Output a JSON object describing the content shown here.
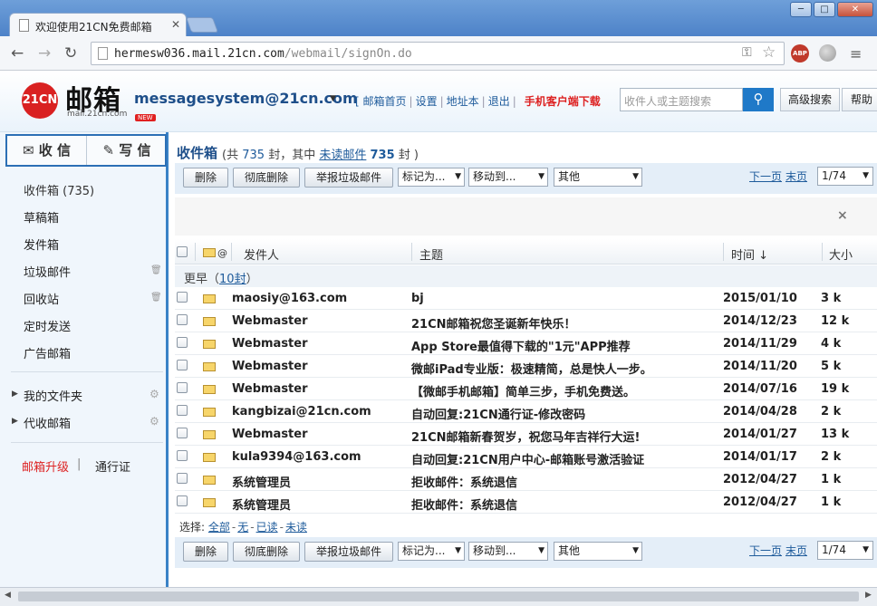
{
  "browser": {
    "tab_title": "欢迎使用21CN免费邮箱",
    "url_host": "hermesw036.mail.21cn.com",
    "url_path": "/webmail/signOn.do",
    "abp_label": "ABP",
    "min": "─",
    "max": "□",
    "close": "✕"
  },
  "header": {
    "logo_badge": "21CN",
    "logo_text": "邮箱",
    "logo_sub": "mail.21cn.com",
    "new_badge": "NEW",
    "account": "messagesystem@21cn.com",
    "links": [
      "邮箱首页",
      "设置",
      "地址本",
      "退出"
    ],
    "mobile_link": "手机客户端下载",
    "search_placeholder": "收件人或主题搜索",
    "advanced_search": "高级搜索",
    "help": "帮助"
  },
  "sidebar": {
    "receive": "收 信",
    "write": "写 信",
    "folders": [
      {
        "label": "收件箱 (735)",
        "trash": false
      },
      {
        "label": "草稿箱",
        "trash": false
      },
      {
        "label": "发件箱",
        "trash": false
      },
      {
        "label": "垃圾邮件",
        "trash": true
      },
      {
        "label": "回收站",
        "trash": true
      },
      {
        "label": "定时发送",
        "trash": false
      },
      {
        "label": "广告邮箱",
        "trash": false
      }
    ],
    "my_folders": "我的文件夹",
    "proxy_mail": "代收邮箱",
    "upgrade": "邮箱升级",
    "separator": "|",
    "passport": "通行证"
  },
  "main": {
    "title": "收件箱",
    "count_prefix": "(共",
    "total": "735",
    "count_mid": "封，其中",
    "unread_label": "未读邮件",
    "unread_count": "735",
    "count_suffix": "封 )",
    "buttons": {
      "delete": "删除",
      "purge": "彻底删除",
      "report_spam": "举报垃圾邮件",
      "mark_as": "标记为...",
      "move_to": "移动到...",
      "other": "其他"
    },
    "next_page": "下一页",
    "last_page": "末页",
    "page_indicator": "1/74",
    "columns": {
      "attach": "@",
      "sender": "发件人",
      "subject": "主题",
      "time": "时间 ↓",
      "size": "大小"
    },
    "group_label": "更早",
    "group_count": "10封",
    "rows": [
      {
        "sender": "maosiy@163.com",
        "subject": "bj",
        "date": "2015/01/10",
        "size": "3 k"
      },
      {
        "sender": "Webmaster",
        "subject": "21CN邮箱祝您圣诞新年快乐！",
        "date": "2014/12/23",
        "size": "12 k"
      },
      {
        "sender": "Webmaster",
        "subject": "App Store最值得下载的\"1元\"APP推荐",
        "date": "2014/11/29",
        "size": "4 k"
      },
      {
        "sender": "Webmaster",
        "subject": "微邮iPad专业版：极速精简，总是快人一步。",
        "date": "2014/11/20",
        "size": "5 k"
      },
      {
        "sender": "Webmaster",
        "subject": "【微邮手机邮箱】简单三步，手机免费送。",
        "date": "2014/07/16",
        "size": "19 k"
      },
      {
        "sender": "kangbizai@21cn.com",
        "subject": "自动回复:21CN通行证-修改密码",
        "date": "2014/04/28",
        "size": "2 k"
      },
      {
        "sender": "Webmaster",
        "subject": "21CN邮箱新春贺岁，祝您马年吉祥行大运!",
        "date": "2014/01/27",
        "size": "13 k"
      },
      {
        "sender": "kula9394@163.com",
        "subject": "自动回复:21CN用户中心-邮箱账号激活验证",
        "date": "2014/01/17",
        "size": "2 k"
      },
      {
        "sender": "系统管理员",
        "subject": "拒收邮件：系统退信",
        "date": "2012/04/27",
        "size": "1 k"
      },
      {
        "sender": "系统管理员",
        "subject": "拒收邮件：系统退信",
        "date": "2012/04/27",
        "size": "1 k"
      }
    ],
    "select_label": "选择:",
    "select_all": "全部",
    "select_none": "无",
    "select_read": "已读",
    "select_unread": "未读"
  }
}
